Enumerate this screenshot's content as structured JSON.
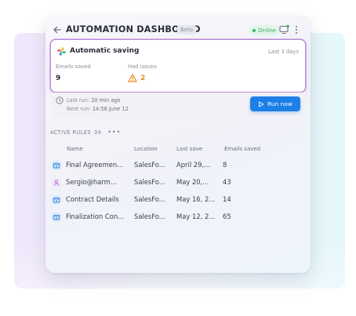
{
  "header": {
    "title": "AUTOMATION DASHBOARD",
    "beta": "Beta",
    "status": "Online"
  },
  "summary": {
    "title": "Automatic saving",
    "period": "Last 3 days",
    "emails_saved_label": "Emails saved",
    "emails_saved_value": "9",
    "had_issues_label": "Had issues",
    "had_issues_value": "2"
  },
  "run": {
    "last_label": "Last run:",
    "last_value": "20 min ago",
    "next_label": "Next run:",
    "next_value": "14:56 June 12",
    "button_label": "Run now"
  },
  "rules": {
    "heading": "ACTIVE RULES",
    "count": "34",
    "columns": {
      "name": "Name",
      "location": "Location",
      "last_save": "Last save",
      "emails_saved": "Emails saved"
    },
    "rows": [
      {
        "icon": "shared-folder-icon",
        "name": "Final Agreemen...",
        "location": "SalesFo...",
        "last_save": "April 29,...",
        "emails": "8"
      },
      {
        "icon": "contact-icon",
        "name": "Sergio@harm...",
        "location": "SalesFo...",
        "last_save": "May 20,...",
        "emails": "43"
      },
      {
        "icon": "shared-folder-icon",
        "name": "Contract Details",
        "location": "SalesFo...",
        "last_save": "May 16, 2...",
        "emails": "14"
      },
      {
        "icon": "shared-folder-icon",
        "name": "Finalization Con...",
        "location": "SalesFo...",
        "last_save": "May 12, 2...",
        "emails": "65"
      }
    ]
  },
  "colors": {
    "accent": "#1d7fe8",
    "online": "#3db36b",
    "warning": "#f08a1c",
    "card_highlight": "#b98ad6"
  }
}
